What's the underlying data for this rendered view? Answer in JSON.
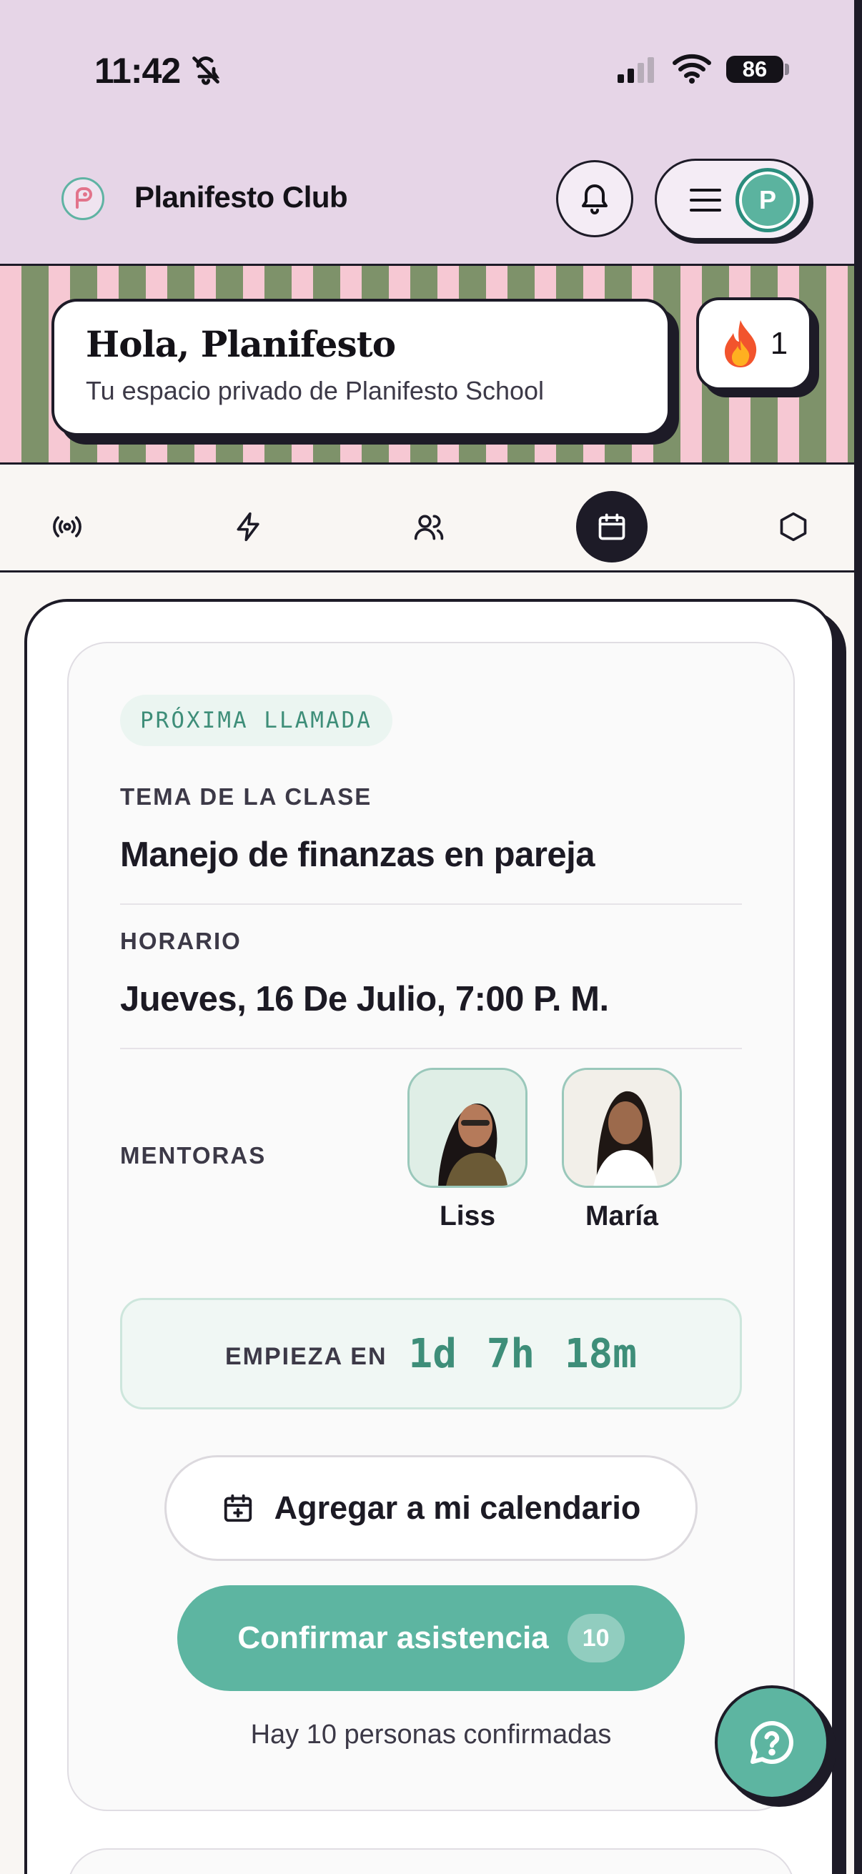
{
  "status_bar": {
    "time": "11:42",
    "battery": "86"
  },
  "header": {
    "app_title": "Planifesto Club",
    "avatar_initial": "P"
  },
  "hero": {
    "greeting": "Hola, Planifesto",
    "subtitle": "Tu espacio privado de Planifesto School",
    "streak_count": "1"
  },
  "tabs": [
    {
      "icon": "broadcast-icon",
      "active": false
    },
    {
      "icon": "lightning-icon",
      "active": false
    },
    {
      "icon": "users-icon",
      "active": false
    },
    {
      "icon": "calendar-icon",
      "active": true
    },
    {
      "icon": "hexagon-icon",
      "active": false
    }
  ],
  "call": {
    "badge": "PRÓXIMA LLAMADA",
    "topic_label": "TEMA DE LA CLASE",
    "topic": "Manejo de finanzas en pareja",
    "schedule_label": "HORARIO",
    "schedule": "Jueves, 16 De Julio, 7:00 P. M.",
    "mentors_label": "MENTORAS",
    "mentors": [
      {
        "name": "Liss"
      },
      {
        "name": "María"
      }
    ],
    "countdown_label": "EMPIEZA EN",
    "countdown_value": "1d 7h 18m",
    "add_calendar_label": "Agregar a mi calendario",
    "confirm_label": "Confirmar asistencia",
    "confirm_count": "10",
    "confirmed_text": "Hay 10 personas confirmadas"
  },
  "colors": {
    "accent": "#5db5a1",
    "header_bg": "#e6d5e7",
    "ink": "#1d1b27"
  }
}
